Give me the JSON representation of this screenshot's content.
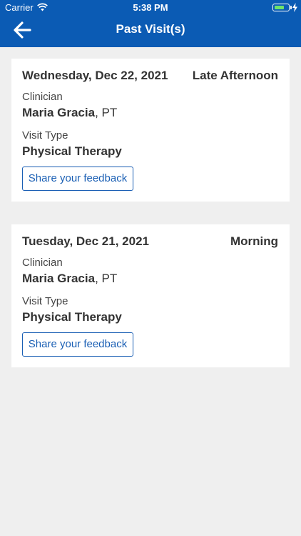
{
  "status_bar": {
    "carrier": "Carrier",
    "time": "5:38 PM"
  },
  "nav": {
    "title": "Past Visit(s)",
    "back_icon": "arrow-left-icon"
  },
  "colors": {
    "header": "#0b5bb4",
    "accent": "#1a5fb4",
    "background": "#efefef",
    "battery": "#6ee36a"
  },
  "visits": [
    {
      "date": "Wednesday, Dec 22, 2021",
      "time_of_day": "Late Afternoon",
      "clinician_label": "Clinician",
      "clinician_name": "Maria Gracia",
      "clinician_suffix": ", PT",
      "visit_type_label": "Visit Type",
      "visit_type": "Physical Therapy",
      "feedback_label": "Share your feedback"
    },
    {
      "date": "Tuesday, Dec 21, 2021",
      "time_of_day": "Morning",
      "clinician_label": "Clinician",
      "clinician_name": "Maria Gracia",
      "clinician_suffix": ", PT",
      "visit_type_label": "Visit Type",
      "visit_type": "Physical Therapy",
      "feedback_label": "Share your feedback"
    }
  ]
}
